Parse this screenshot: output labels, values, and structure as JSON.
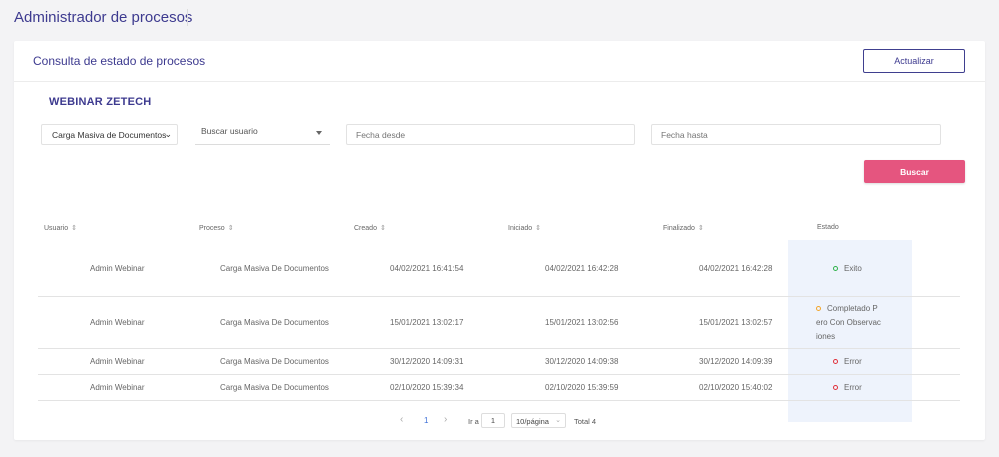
{
  "app_title": "Administrador de procesos",
  "card": {
    "title": "Consulta de estado de procesos",
    "refresh_label": "Actualizar",
    "company": "WEBINAR ZETECH"
  },
  "filters": {
    "process_value": "Carga Masiva de Documentos",
    "user_placeholder": "Buscar usuario",
    "date_from_placeholder": "Fecha desde",
    "date_to_placeholder": "Fecha hasta",
    "search_label": "Buscar"
  },
  "table": {
    "headers": [
      "Usuario",
      "Proceso",
      "Creado",
      "Iniciado",
      "Finalizado",
      "Estado"
    ],
    "rows": [
      {
        "usuario": "Admin Webinar",
        "proceso": "Carga Masiva De Documentos",
        "creado": "04/02/2021 16:41:54",
        "iniciado": "04/02/2021 16:42:28",
        "finalizado": "04/02/2021 16:42:28",
        "estado_lines": [
          "Exito"
        ],
        "status_color": "#2fb24a"
      },
      {
        "usuario": "Admin Webinar",
        "proceso": "Carga Masiva De Documentos",
        "creado": "15/01/2021 13:02:17",
        "iniciado": "15/01/2021 13:02:56",
        "finalizado": "15/01/2021 13:02:57",
        "estado_lines": [
          "Completado P",
          "ero Con Observac",
          "iones"
        ],
        "status_color": "#f2a52b"
      },
      {
        "usuario": "Admin Webinar",
        "proceso": "Carga Masiva De Documentos",
        "creado": "30/12/2020 14:09:31",
        "iniciado": "30/12/2020 14:09:38",
        "finalizado": "30/12/2020 14:09:39",
        "estado_lines": [
          "Error"
        ],
        "status_color": "#e0303a"
      },
      {
        "usuario": "Admin Webinar",
        "proceso": "Carga Masiva De Documentos",
        "creado": "02/10/2020 15:39:34",
        "iniciado": "02/10/2020 15:39:59",
        "finalizado": "02/10/2020 15:40:02",
        "estado_lines": [
          "Error"
        ],
        "status_color": "#e0303a"
      }
    ]
  },
  "pagination": {
    "current_page": "1",
    "goto_label": "Ir a",
    "goto_value": "1",
    "page_size": "10/página",
    "total": "Total 4"
  },
  "colors": {
    "accent": "#3d3a8f",
    "search_button": "#e5557f"
  }
}
